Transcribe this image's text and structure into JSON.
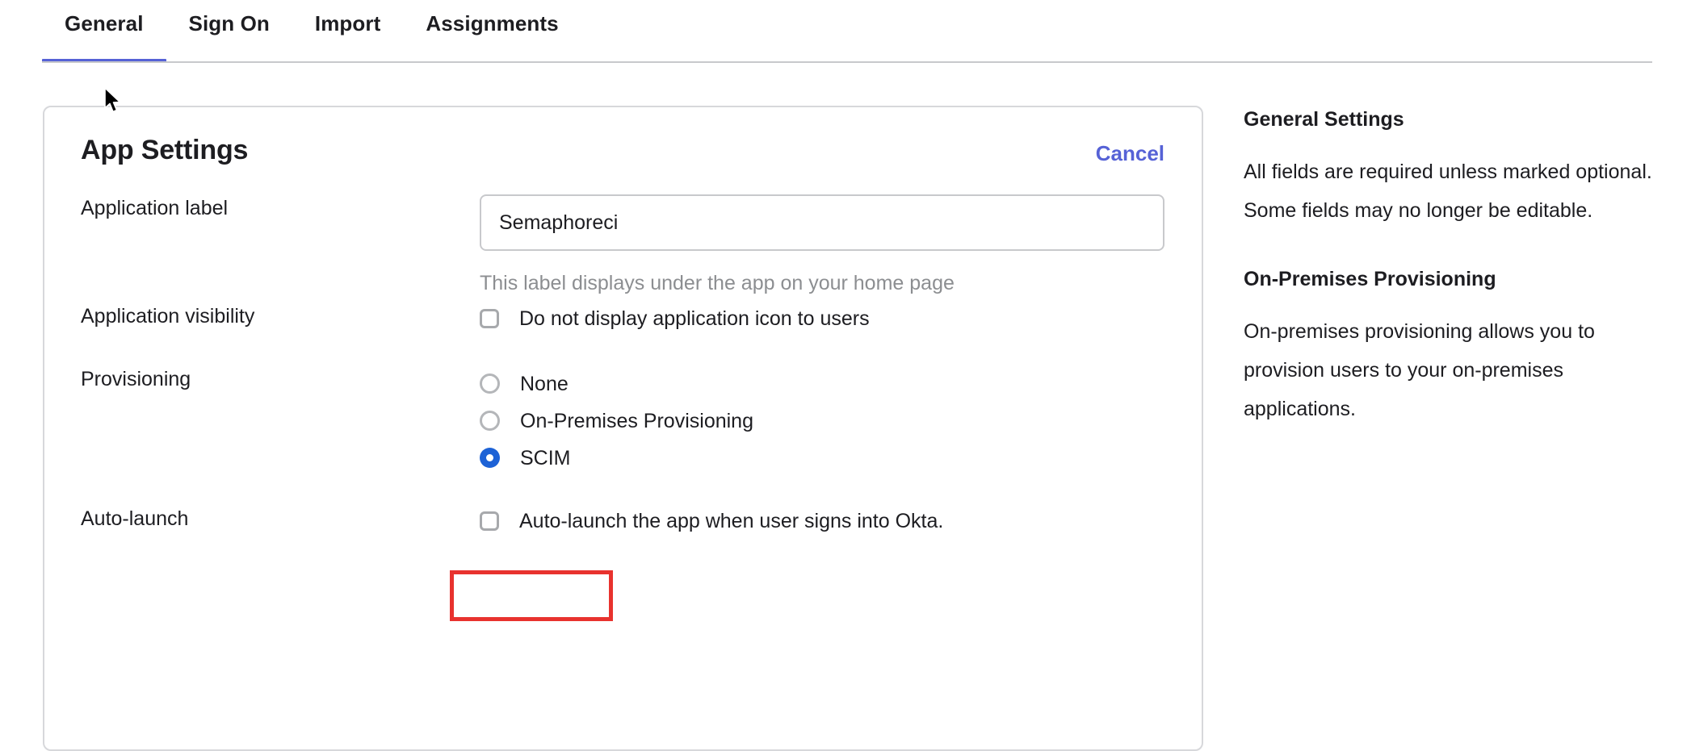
{
  "tabs": [
    {
      "label": "General",
      "active": true
    },
    {
      "label": "Sign On",
      "active": false
    },
    {
      "label": "Import",
      "active": false
    },
    {
      "label": "Assignments",
      "active": false
    }
  ],
  "card": {
    "title": "App Settings",
    "cancel_label": "Cancel",
    "fields": {
      "application_label": {
        "label": "Application label",
        "value": "Semaphoreci",
        "placeholder": "Application label",
        "hint": "This label displays under the app on your home page"
      },
      "application_visibility": {
        "label": "Application visibility",
        "checkbox_label": "Do not display application icon to users",
        "checked": false
      },
      "provisioning": {
        "label": "Provisioning",
        "options": [
          {
            "label": "None",
            "selected": false
          },
          {
            "label": "On-Premises Provisioning",
            "selected": false
          },
          {
            "label": "SCIM",
            "selected": true
          }
        ]
      },
      "auto_launch": {
        "label": "Auto-launch",
        "checkbox_label": "Auto-launch the app when user signs into Okta.",
        "checked": false
      }
    }
  },
  "help_panel": {
    "sections": [
      {
        "heading": "General Settings",
        "body": "All fields are required unless marked optional. Some fields may no longer be editable."
      },
      {
        "heading": "On-Premises Provisioning",
        "body": "On-premises provisioning allows you to provision users to your on-premises applications."
      }
    ]
  },
  "colors": {
    "accent": "#5662d6",
    "radio_selected": "#1d62d6",
    "highlight": "#e8322e",
    "border": "#d7d8db",
    "hint_text": "#8c8e91"
  }
}
